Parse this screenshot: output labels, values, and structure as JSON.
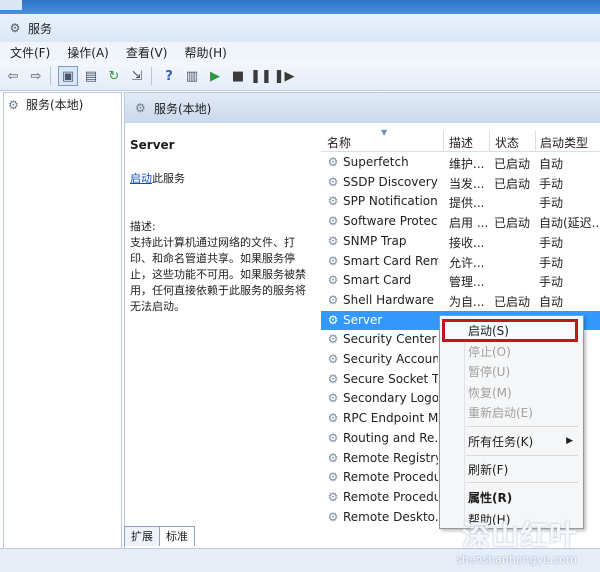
{
  "window": {
    "title": "服务"
  },
  "menu": [
    "文件(F)",
    "操作(A)",
    "查看(V)",
    "帮助(H)"
  ],
  "toolbar": {
    "icons": [
      "back-icon",
      "forward-icon",
      "console-tree-icon",
      "properties-pane-icon",
      "refresh-icon",
      "export-icon",
      "help-icon",
      "show-hide-icon",
      "play-icon",
      "stop-icon",
      "pause-icon",
      "restart-icon"
    ]
  },
  "tree": {
    "root": "服务(本地)"
  },
  "pane": {
    "header": "服务(本地)",
    "service_name": "Server",
    "start_link": "启动",
    "start_suffix": "此服务",
    "desc_label": "描述:",
    "desc_text": "支持此计算机通过网络的文件、打印、和命名管道共享。如果服务停止，这些功能不可用。如果服务被禁用，任何直接依赖于此服务的服务将无法启动。"
  },
  "columns": [
    "名称",
    "描述",
    "状态",
    "启动类型"
  ],
  "rows": [
    {
      "name": "Superfetch",
      "desc": "维护...",
      "status": "已启动",
      "type": "自动"
    },
    {
      "name": "SSDP Discovery",
      "desc": "当发...",
      "status": "已启动",
      "type": "手动"
    },
    {
      "name": "SPP Notification ...",
      "desc": "提供...",
      "status": "",
      "type": "手动"
    },
    {
      "name": "Software Protect...",
      "desc": "启用 ...",
      "status": "已启动",
      "type": "自动(延迟..."
    },
    {
      "name": "SNMP Trap",
      "desc": "接收...",
      "status": "",
      "type": "手动"
    },
    {
      "name": "Smart Card Rem...",
      "desc": "允许...",
      "status": "",
      "type": "手动"
    },
    {
      "name": "Smart Card",
      "desc": "管理...",
      "status": "",
      "type": "手动"
    },
    {
      "name": "Shell Hardware ...",
      "desc": "为自...",
      "status": "已启动",
      "type": "自动"
    },
    {
      "name": "Server",
      "desc": "支持...",
      "status": "",
      "type": "自动"
    },
    {
      "name": "Security Center",
      "desc": "",
      "status": "",
      "type": ""
    },
    {
      "name": "Security Account...",
      "desc": "",
      "status": "",
      "type": ""
    },
    {
      "name": "Secure Socket T...",
      "desc": "",
      "status": "",
      "type": ""
    },
    {
      "name": "Secondary Logon",
      "desc": "",
      "status": "",
      "type": ""
    },
    {
      "name": "RPC Endpoint M...",
      "desc": "",
      "status": "",
      "type": ""
    },
    {
      "name": "Routing and Re...",
      "desc": "",
      "status": "",
      "type": ""
    },
    {
      "name": "Remote Registry",
      "desc": "",
      "status": "",
      "type": ""
    },
    {
      "name": "Remote Procedu...",
      "desc": "",
      "status": "",
      "type": ""
    },
    {
      "name": "Remote Procedu...",
      "desc": "",
      "status": "",
      "type": ""
    },
    {
      "name": "Remote Deskto...",
      "desc": "",
      "status": "",
      "type": ""
    }
  ],
  "selected_row": 8,
  "context_menu": {
    "start": "启动(S)",
    "stop": "停止(O)",
    "pause": "暂停(U)",
    "resume": "恢复(M)",
    "restart": "重新启动(E)",
    "all_tasks": "所有任务(K)",
    "refresh": "刷新(F)",
    "properties": "属性(R)",
    "help": "帮助(H)"
  },
  "tabs": [
    "扩展",
    "标准"
  ],
  "watermark": {
    "cn": "深山红叶",
    "en": "shenshanhongye.com"
  },
  "colors": {
    "selection": "#3399ff",
    "highlight_border": "#c3161c",
    "link": "#0a4fbf"
  }
}
